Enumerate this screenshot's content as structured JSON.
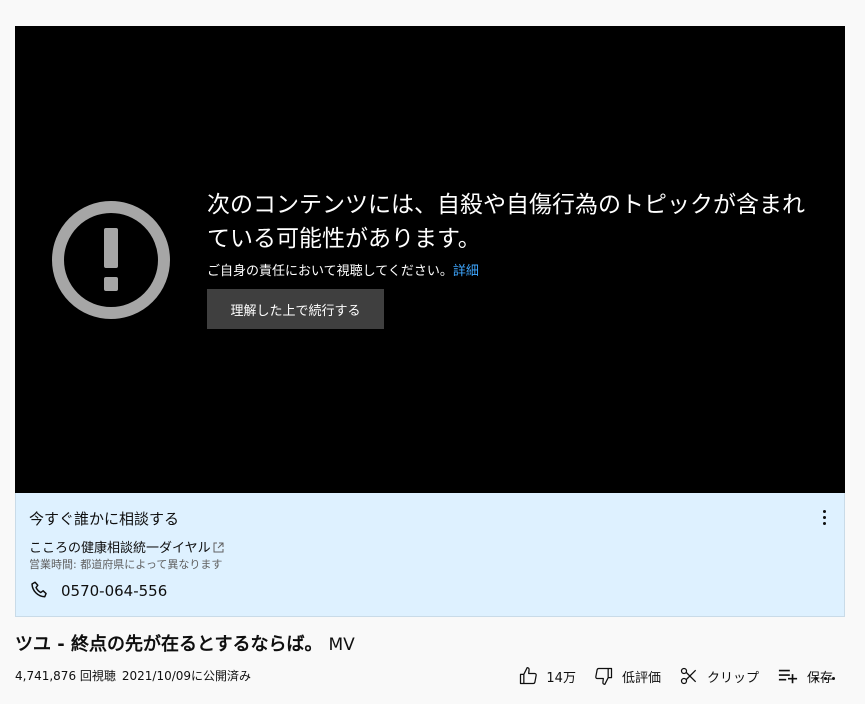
{
  "player": {
    "warning_title": "次のコンテンツには、自殺や自傷行為のトピックが含まれている可能性があります。",
    "warning_sub": "ご自身の責任において視聴してください。",
    "learn_more": "詳細",
    "continue_label": "理解した上で続行する"
  },
  "crisis_panel": {
    "title": "今すぐ誰かに相談する",
    "org_name": "こころの健康相談統一ダイヤル",
    "hours": "営業時間: 都道府県によって異なります",
    "phone": "0570-064-556"
  },
  "video": {
    "title": "ツユ - 終点の先が在るとするならば。",
    "title_suffix": "MV",
    "views": "4,741,876 回視聴",
    "published": "2021/10/09に公開済み"
  },
  "actions": {
    "like_count": "14万",
    "dislike_label": "低評価",
    "clip_label": "クリップ",
    "save_label": "保存"
  },
  "colors": {
    "player_bg": "#000000",
    "link": "#3ea6ff",
    "panel_bg": "#def1ff",
    "button_bg": "#3f3f3f"
  }
}
